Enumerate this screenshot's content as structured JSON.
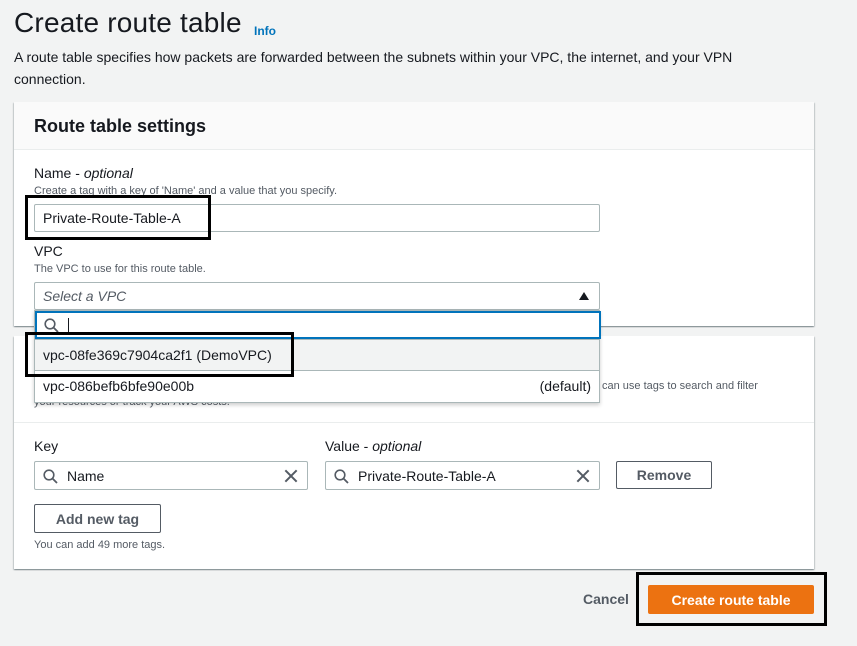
{
  "header": {
    "title": "Create route table",
    "info_label": "Info",
    "description": "A route table specifies how packets are forwarded between the subnets within your VPC, the internet, and your VPN connection."
  },
  "settings": {
    "title": "Route table settings",
    "name_label": "Name",
    "name_optional": "optional",
    "name_desc": "Create a tag with a key of 'Name' and a value that you specify.",
    "name_value": "Private-Route-Table-A",
    "vpc_label": "VPC",
    "vpc_desc": "The VPC to use for this route table.",
    "vpc_placeholder": "Select a VPC"
  },
  "vpc_dropdown": {
    "search_value": "",
    "options": [
      {
        "label": "vpc-08fe369c7904ca2f1 (DemoVPC)",
        "tag": ""
      },
      {
        "label": "vpc-086befb6bfe90e00b",
        "tag": "(default)"
      }
    ]
  },
  "tags": {
    "hint_right": "can use tags to search and filter",
    "hint_left": "your resources or track your AWS costs.",
    "key_label": "Key",
    "value_label": "Value",
    "value_optional": "optional",
    "key_value": "Name",
    "value_value": "Private-Route-Table-A",
    "remove_label": "Remove",
    "add_label": "Add new tag",
    "remaining": "You can add 49 more tags."
  },
  "footer": {
    "cancel_label": "Cancel",
    "create_label": "Create route table"
  },
  "colors": {
    "primary": "#ec7211",
    "link": "#0073bb",
    "focus": "#0073bb"
  }
}
